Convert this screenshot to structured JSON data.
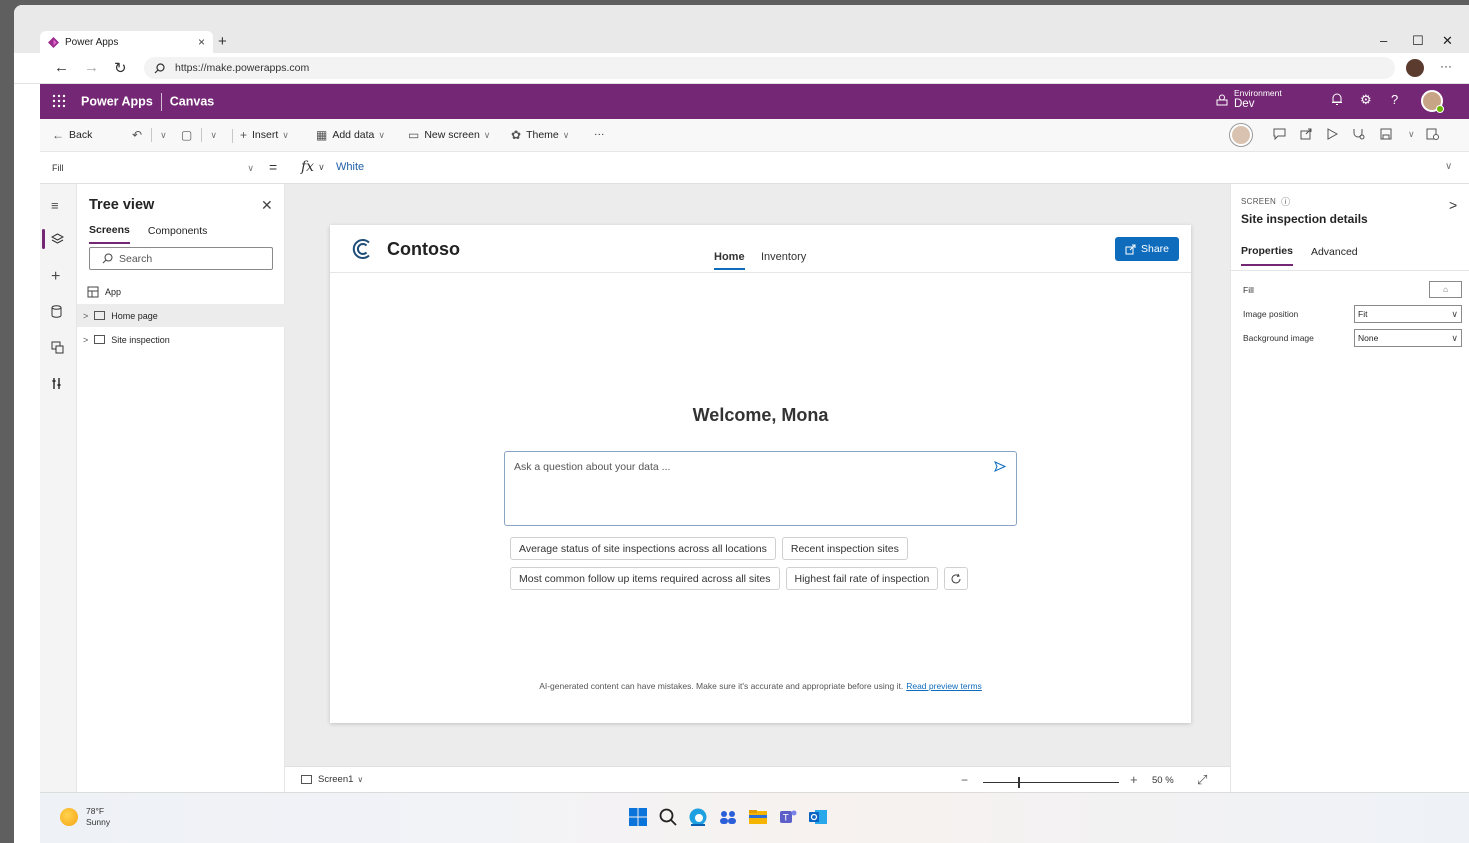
{
  "browser": {
    "tab_title": "Power Apps",
    "url": "https://make.powerapps.com"
  },
  "app_header": {
    "product": "Power Apps",
    "mode": "Canvas",
    "environment_label": "Environment",
    "environment_value": "Dev"
  },
  "commands": {
    "back": "Back",
    "insert": "Insert",
    "add_data": "Add data",
    "new_screen": "New screen",
    "theme": "Theme",
    "more": "···"
  },
  "formula": {
    "property": "Fill",
    "equals": "=",
    "fx": "fx",
    "value": "White"
  },
  "tree": {
    "title": "Tree view",
    "tabs": [
      "Screens",
      "Components"
    ],
    "search_placeholder": "Search",
    "items": [
      "App",
      "Home page",
      "Site inspection"
    ]
  },
  "preview": {
    "logo_text": "Contoso",
    "nav": [
      "Home",
      "Inventory"
    ],
    "share": "Share",
    "welcome": "Welcome, Mona",
    "ask_placeholder": "Ask a question about your data ...",
    "suggestions": [
      "Average status of site inspections across all locations",
      "Recent inspection sites",
      "Most common follow up items required across all sites",
      "Highest fail rate of inspection"
    ],
    "disclaimer": "AI-generated content can have mistakes. Make sure it's accurate and appropriate before using it.",
    "disclaimer_link": "Read preview terms"
  },
  "canvas_footer": {
    "screen": "Screen1",
    "zoom_minus": "−",
    "zoom_plus": "+",
    "zoom": "50 %"
  },
  "properties": {
    "kind": "SCREEN",
    "name": "Site inspection details",
    "tabs": [
      "Properties",
      "Advanced"
    ],
    "fill_label": "Fill",
    "image_position_label": "Image position",
    "image_position_value": "Fit",
    "background_image_label": "Background image",
    "background_image_value": "None"
  },
  "taskbar": {
    "temperature": "78°F",
    "condition": "Sunny"
  },
  "colors": {
    "brand": "#742774",
    "accent": "#0f6cbd"
  }
}
